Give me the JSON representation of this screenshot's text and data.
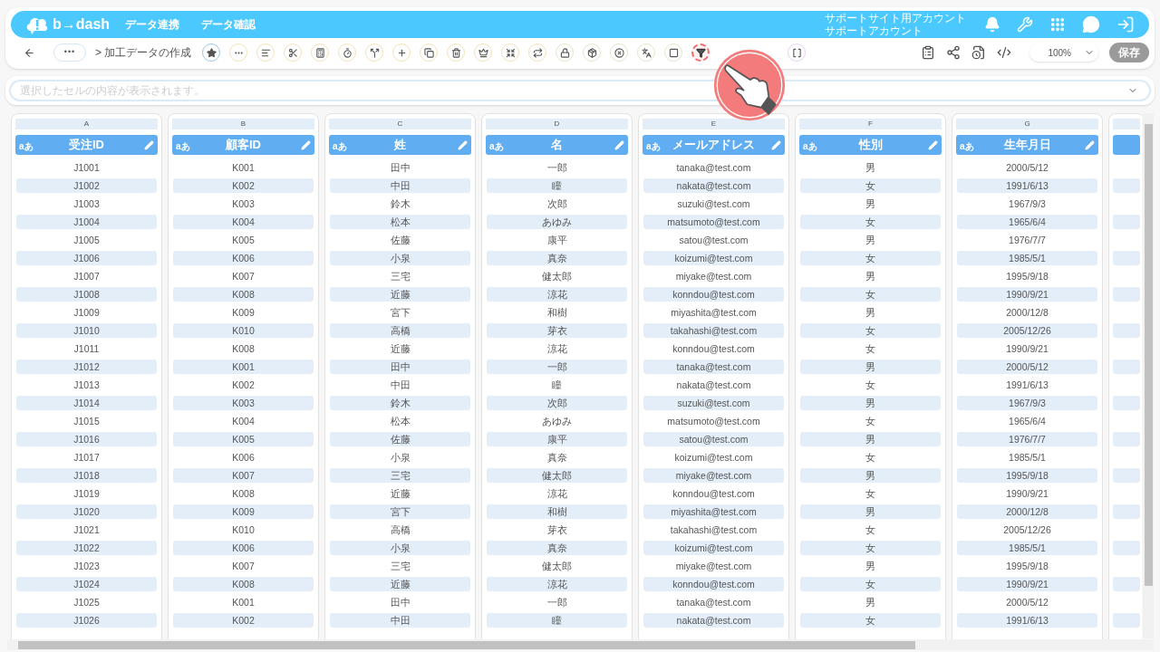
{
  "logo": "b→dash",
  "nav": [
    "データ連携",
    "データ確認"
  ],
  "account": {
    "site": "サポートサイト用アカウント",
    "name": "サポートアカウント"
  },
  "breadcrumb": {
    "more": "•••",
    "current": "> 加工データの作成"
  },
  "tools": [
    {
      "kind": "star",
      "highlighted": false
    },
    {
      "kind": "dots",
      "highlighted": false
    },
    {
      "kind": "lines",
      "highlighted": false
    },
    {
      "kind": "scissors",
      "highlighted": false
    },
    {
      "kind": "calc",
      "highlighted": false
    },
    {
      "kind": "timer",
      "highlighted": false
    },
    {
      "kind": "split",
      "highlighted": false
    },
    {
      "kind": "plus",
      "highlighted": false
    },
    {
      "kind": "copy",
      "highlighted": false
    },
    {
      "kind": "trash",
      "highlighted": false
    },
    {
      "kind": "crown",
      "highlighted": false
    },
    {
      "kind": "shrink",
      "highlighted": false
    },
    {
      "kind": "repeat",
      "highlighted": false
    },
    {
      "kind": "lock",
      "highlighted": false
    },
    {
      "kind": "package",
      "highlighted": false
    },
    {
      "kind": "x",
      "highlighted": false
    },
    {
      "kind": "translate",
      "highlighted": false
    },
    {
      "kind": "square",
      "highlighted": false
    },
    {
      "kind": "filter",
      "highlighted": true
    },
    {
      "kind": "brackets",
      "highlighted": false
    }
  ],
  "zoom": "100%",
  "save": {
    "label": "保存",
    "disabled": true
  },
  "cell_bar": {
    "placeholder": "選択したセルの内容が表示されます。"
  },
  "table": {
    "columns": [
      {
        "letter": "A",
        "type_tag": "aあ",
        "name": "受注ID"
      },
      {
        "letter": "B",
        "type_tag": "aあ",
        "name": "顧客ID"
      },
      {
        "letter": "C",
        "type_tag": "aあ",
        "name": "姓"
      },
      {
        "letter": "D",
        "type_tag": "aあ",
        "name": "名"
      },
      {
        "letter": "E",
        "type_tag": "aあ",
        "name": "メールアドレス"
      },
      {
        "letter": "F",
        "type_tag": "aあ",
        "name": "性別"
      },
      {
        "letter": "G",
        "type_tag": "aあ",
        "name": "生年月日"
      }
    ],
    "rows": [
      [
        "J1001",
        "K001",
        "田中",
        "一郎",
        "tanaka@test.com",
        "男",
        "2000/5/12"
      ],
      [
        "J1002",
        "K002",
        "中田",
        "瞳",
        "nakata@test.com",
        "女",
        "1991/6/13"
      ],
      [
        "J1003",
        "K003",
        "鈴木",
        "次郎",
        "suzuki@test.com",
        "男",
        "1967/9/3"
      ],
      [
        "J1004",
        "K004",
        "松本",
        "あゆみ",
        "matsumoto@test.com",
        "女",
        "1965/6/4"
      ],
      [
        "J1005",
        "K005",
        "佐藤",
        "康平",
        "satou@test.com",
        "男",
        "1976/7/7"
      ],
      [
        "J1006",
        "K006",
        "小泉",
        "真奈",
        "koizumi@test.com",
        "女",
        "1985/5/1"
      ],
      [
        "J1007",
        "K007",
        "三宅",
        "健太郎",
        "miyake@test.com",
        "男",
        "1995/9/18"
      ],
      [
        "J1008",
        "K008",
        "近藤",
        "涼花",
        "konndou@test.com",
        "女",
        "1990/9/21"
      ],
      [
        "J1009",
        "K009",
        "宮下",
        "和樹",
        "miyashita@test.com",
        "男",
        "2000/12/8"
      ],
      [
        "J1010",
        "K010",
        "高橋",
        "芽衣",
        "takahashi@test.com",
        "女",
        "2005/12/26"
      ],
      [
        "J1011",
        "K008",
        "近藤",
        "涼花",
        "konndou@test.com",
        "女",
        "1990/9/21"
      ],
      [
        "J1012",
        "K001",
        "田中",
        "一郎",
        "tanaka@test.com",
        "男",
        "2000/5/12"
      ],
      [
        "J1013",
        "K002",
        "中田",
        "瞳",
        "nakata@test.com",
        "女",
        "1991/6/13"
      ],
      [
        "J1014",
        "K003",
        "鈴木",
        "次郎",
        "suzuki@test.com",
        "男",
        "1967/9/3"
      ],
      [
        "J1015",
        "K004",
        "松本",
        "あゆみ",
        "matsumoto@test.com",
        "女",
        "1965/6/4"
      ],
      [
        "J1016",
        "K005",
        "佐藤",
        "康平",
        "satou@test.com",
        "男",
        "1976/7/7"
      ],
      [
        "J1017",
        "K006",
        "小泉",
        "真奈",
        "koizumi@test.com",
        "女",
        "1985/5/1"
      ],
      [
        "J1018",
        "K007",
        "三宅",
        "健太郎",
        "miyake@test.com",
        "男",
        "1995/9/18"
      ],
      [
        "J1019",
        "K008",
        "近藤",
        "涼花",
        "konndou@test.com",
        "女",
        "1990/9/21"
      ],
      [
        "J1020",
        "K009",
        "宮下",
        "和樹",
        "miyashita@test.com",
        "男",
        "2000/12/8"
      ],
      [
        "J1021",
        "K010",
        "高橋",
        "芽衣",
        "takahashi@test.com",
        "女",
        "2005/12/26"
      ],
      [
        "J1022",
        "K006",
        "小泉",
        "真奈",
        "koizumi@test.com",
        "女",
        "1985/5/1"
      ],
      [
        "J1023",
        "K007",
        "三宅",
        "健太郎",
        "miyake@test.com",
        "男",
        "1995/9/18"
      ],
      [
        "J1024",
        "K008",
        "近藤",
        "涼花",
        "konndou@test.com",
        "女",
        "1990/9/21"
      ],
      [
        "J1025",
        "K001",
        "田中",
        "一郎",
        "tanaka@test.com",
        "男",
        "2000/5/12"
      ],
      [
        "J1026",
        "K002",
        "中田",
        "瞳",
        "nakata@test.com",
        "女",
        "1991/6/13"
      ]
    ]
  }
}
